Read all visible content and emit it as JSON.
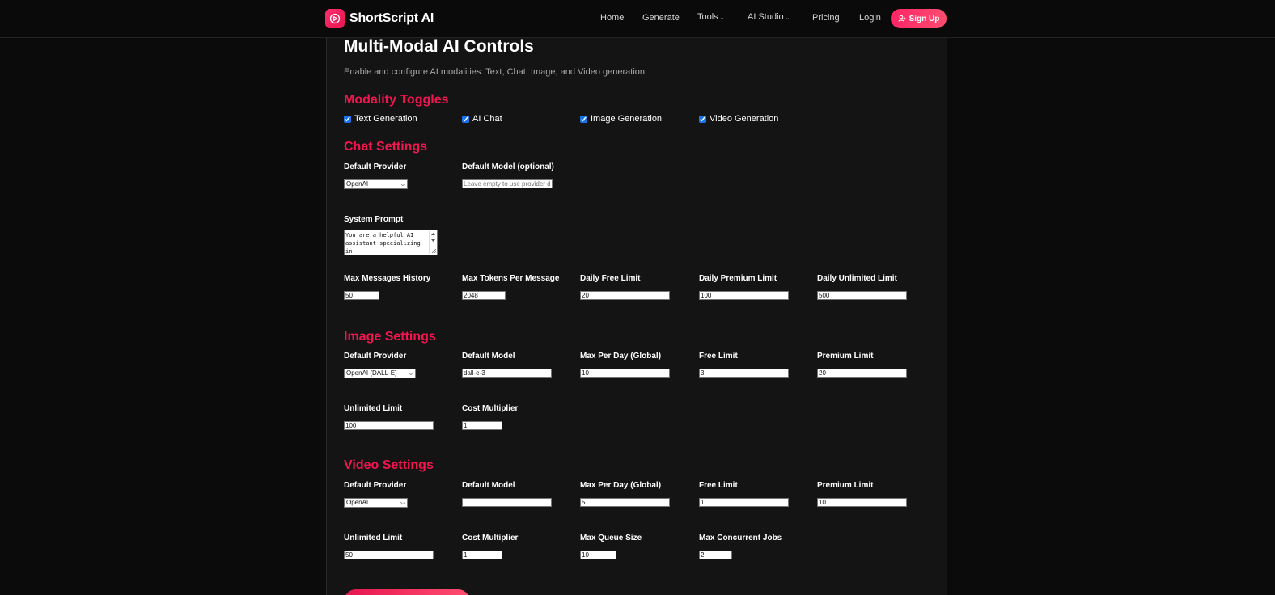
{
  "nav": {
    "brand": "ShortScript AI",
    "links": [
      "Home",
      "Generate",
      "Tools",
      "AI Studio",
      "Pricing",
      "Login"
    ],
    "signup": "Sign Up"
  },
  "page": {
    "title": "Multi-Modal AI Controls",
    "subtitle": "Enable and configure AI modalities: Text, Chat, Image, and Video generation."
  },
  "modality": {
    "title": "Modality Toggles",
    "toggles": [
      {
        "label": "Text Generation",
        "checked": true
      },
      {
        "label": "AI Chat",
        "checked": true
      },
      {
        "label": "Image Generation",
        "checked": true
      },
      {
        "label": "Video Generation",
        "checked": true
      }
    ]
  },
  "chat": {
    "title": "Chat Settings",
    "provider_label": "Default Provider",
    "provider_value": "OpenAI",
    "model_label": "Default Model (optional)",
    "model_placeholder": "Leave empty to use provider default",
    "system_prompt_label": "System Prompt",
    "system_prompt_value": "You are a helpful AI assistant specializing in",
    "max_history_label": "Max Messages History",
    "max_history_value": "50",
    "max_tokens_label": "Max Tokens Per Message",
    "max_tokens_value": "2048",
    "daily_free_label": "Daily Free Limit",
    "daily_free_value": "20",
    "daily_premium_label": "Daily Premium Limit",
    "daily_premium_value": "100",
    "daily_unlimited_label": "Daily Unlimited Limit",
    "daily_unlimited_value": "500"
  },
  "image": {
    "title": "Image Settings",
    "provider_label": "Default Provider",
    "provider_value": "OpenAI (DALL-E)",
    "model_label": "Default Model",
    "model_value": "dall-e-3",
    "max_per_day_label": "Max Per Day (Global)",
    "max_per_day_value": "10",
    "free_label": "Free Limit",
    "free_value": "3",
    "premium_label": "Premium Limit",
    "premium_value": "20",
    "unlimited_label": "Unlimited Limit",
    "unlimited_value": "100",
    "cost_label": "Cost Multiplier",
    "cost_value": "1"
  },
  "video": {
    "title": "Video Settings",
    "provider_label": "Default Provider",
    "provider_value": "OpenAI",
    "model_label": "Default Model",
    "model_value": "",
    "max_per_day_label": "Max Per Day (Global)",
    "max_per_day_value": "5",
    "free_label": "Free Limit",
    "free_value": "1",
    "premium_label": "Premium Limit",
    "premium_value": "10",
    "unlimited_label": "Unlimited Limit",
    "unlimited_value": "50",
    "cost_label": "Cost Multiplier",
    "cost_value": "1",
    "queue_label": "Max Queue Size",
    "queue_value": "10",
    "concurrent_label": "Max Concurrent Jobs",
    "concurrent_value": "2"
  },
  "colors": {
    "accent": "#f2154f",
    "background": "#0b0b0b",
    "panel": "#141414"
  }
}
